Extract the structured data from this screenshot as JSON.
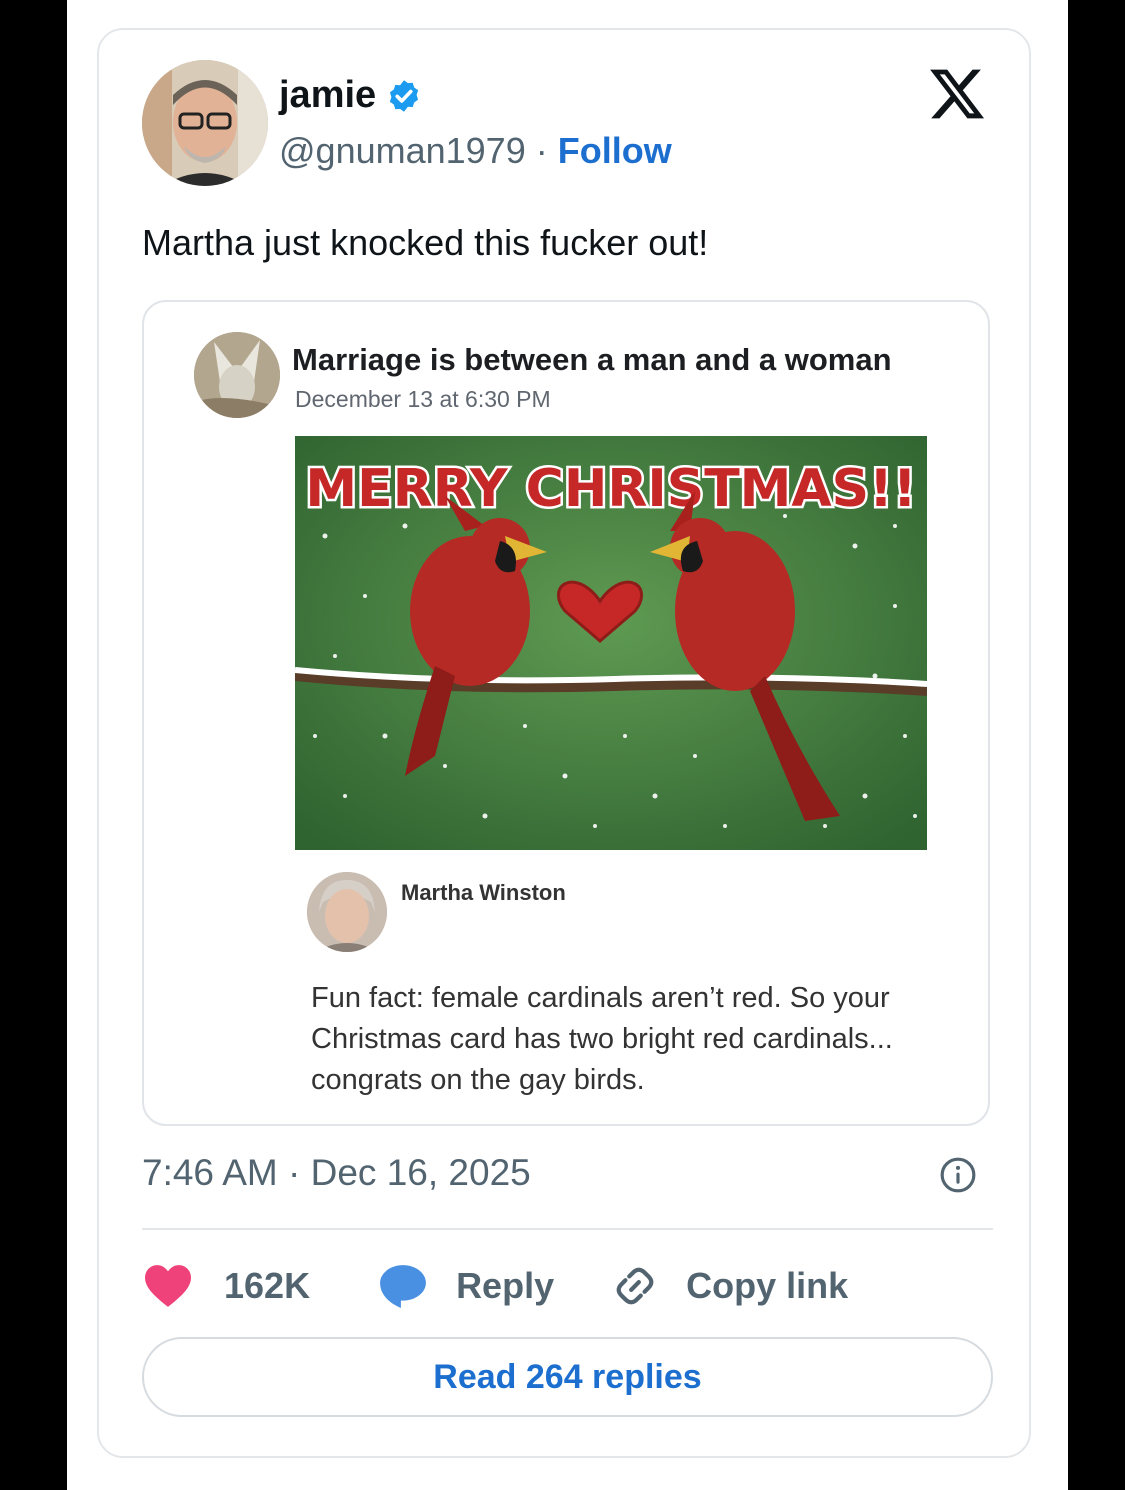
{
  "tweet": {
    "author": {
      "name": "jamie",
      "handle": "@gnuman1979",
      "separator": " · ",
      "follow_label": "Follow",
      "verified": true
    },
    "logo_icon": "x-logo-icon",
    "text": "Martha just knocked this fucker out!",
    "quoted_post": {
      "author": "Marriage is between a man and a woman",
      "date": "December 13 at 6:30 PM",
      "image_caption": "MERRY CHRISTMAS!!",
      "reply": {
        "name": "Martha Winston",
        "text": "Fun fact: female cardinals aren’t red. So your Christmas card has two bright red cardinals... congrats on the gay birds."
      }
    },
    "timestamp": "7:46 AM · Dec 16, 2025",
    "actions": {
      "like_count": "162K",
      "reply_label": "Reply",
      "copy_label": "Copy link"
    },
    "read_replies_label": "Read 264 replies",
    "colors": {
      "accent": "#1d6fcf",
      "like": "#f0427a",
      "reply_bubble": "#4a90e2",
      "text": "#0f1419",
      "muted": "#536471"
    }
  }
}
